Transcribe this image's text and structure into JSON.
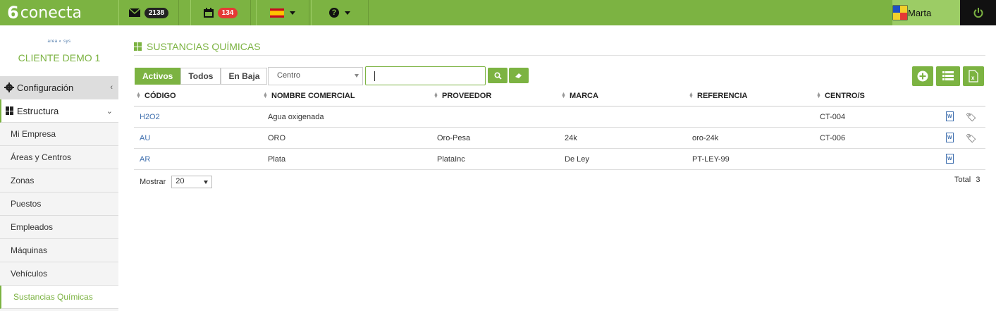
{
  "topbar": {
    "logo_mark": "6",
    "logo_text": "conecta",
    "mail_count": "2138",
    "calendar_count": "134",
    "language": "es",
    "help_label": "?",
    "user_name": "Marta"
  },
  "sidebar": {
    "brand_logo_text": "area ◐ sys",
    "client_name": "CLIENTE DEMO 1",
    "config_label": "Configuración",
    "structure_label": "Estructura",
    "items": [
      {
        "label": "Mi Empresa"
      },
      {
        "label": "Áreas y Centros"
      },
      {
        "label": "Zonas"
      },
      {
        "label": "Puestos"
      },
      {
        "label": "Empleados"
      },
      {
        "label": "Máquinas"
      },
      {
        "label": "Vehículos"
      },
      {
        "label": "Sustancias Químicas"
      }
    ]
  },
  "page": {
    "title": "SUSTANCIAS QUÍMICAS",
    "filters": {
      "active": "Activos",
      "all": "Todos",
      "inactive": "En Baja"
    },
    "center_select": "Centro",
    "search_value": ""
  },
  "table": {
    "columns": [
      "CÓDIGO",
      "NOMBRE COMERCIAL",
      "PROVEEDOR",
      "MARCA",
      "REFERENCIA",
      "CENTRO/S"
    ],
    "rows": [
      {
        "code": "H2O2",
        "name": "Agua oxigenada",
        "supplier": "",
        "brand": "",
        "ref": "",
        "center": "CT-004",
        "has_tag": true
      },
      {
        "code": "AU",
        "name": "ORO",
        "supplier": "Oro-Pesa",
        "brand": "24k",
        "ref": "oro-24k",
        "center": "CT-006",
        "has_tag": true
      },
      {
        "code": "AR",
        "name": "Plata",
        "supplier": "PlataInc",
        "brand": "De Ley",
        "ref": "PT-LEY-99",
        "center": "",
        "has_tag": false
      }
    ]
  },
  "footer": {
    "show_label": "Mostrar",
    "page_size": "20",
    "total_label": "Total",
    "total_value": "3"
  },
  "colors": {
    "accent": "#7cb342",
    "link": "#3f6fae",
    "badge_red": "#e53935"
  },
  "icons": [
    "envelope-icon",
    "calendar-icon",
    "spain-flag-icon",
    "question-icon",
    "power-icon",
    "gear-icon",
    "grid-icon",
    "search-icon",
    "eraser-icon",
    "add-icon",
    "list-icon",
    "excel-icon",
    "word-doc-icon",
    "tags-icon"
  ]
}
